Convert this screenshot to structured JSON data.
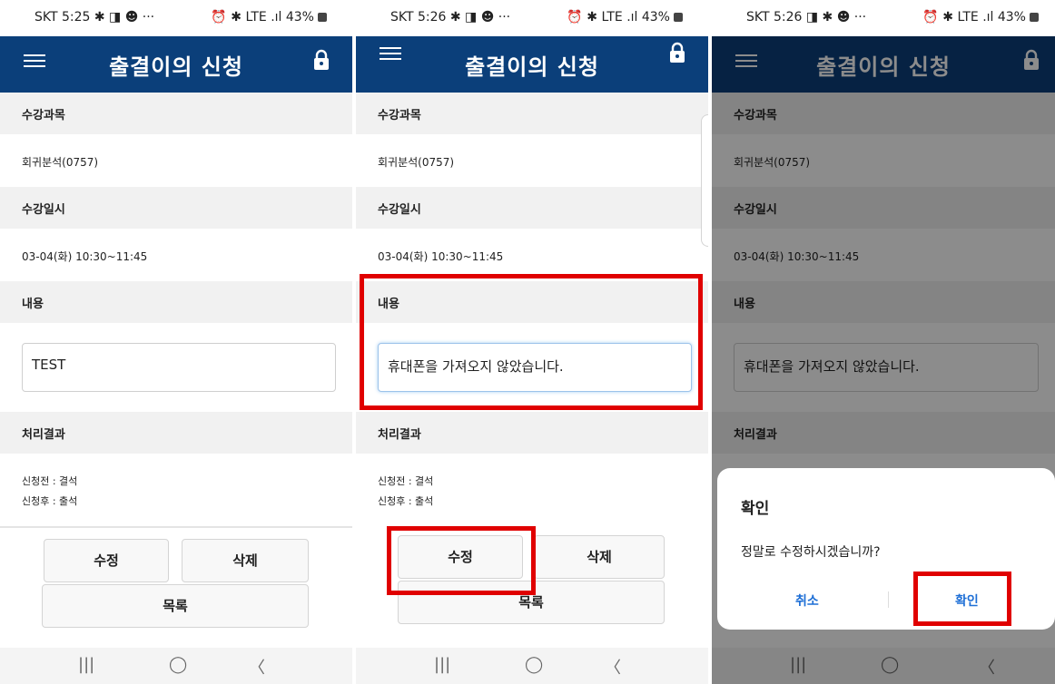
{
  "status": {
    "screen1": {
      "left": "SKT 5:25 ✱ ◨ ☻ ···",
      "right": "⏰ ✱ LTE .ıl 43%"
    },
    "screen2": {
      "left": "SKT 5:26 ✱ ◨ ☻ ···",
      "right": "⏰ ✱ LTE .ıl 43%"
    },
    "screen3": {
      "left": "SKT 5:26 ◨ ✱ ☻ ···",
      "right": "⏰ ✱ LTE .ıl 43%"
    }
  },
  "app": {
    "title": "출결이의 신청"
  },
  "form": {
    "course_label": "수강과목",
    "course_value": "회귀분석(0757)",
    "datetime_label": "수강일시",
    "datetime_value": "03-04(화) 10:30~11:45",
    "content_label": "내용",
    "content_value_1": "TEST",
    "content_value_2": "휴대폰을 가져오지 않았습니다.",
    "result_label": "처리결과",
    "result_before": "신청전 : 결석",
    "result_after": "신청후 : 출석"
  },
  "buttons": {
    "edit": "수정",
    "delete": "삭제",
    "list": "목록"
  },
  "nav": {
    "recent": "|||",
    "home": "◯",
    "back": "〈"
  },
  "dialog": {
    "title": "확인",
    "message": "정말로 수정하시겠습니까?",
    "cancel": "취소",
    "ok": "확인"
  },
  "colors": {
    "appbar": "#0b3f7a",
    "highlight": "#e00000",
    "link": "#1e6fd6"
  }
}
